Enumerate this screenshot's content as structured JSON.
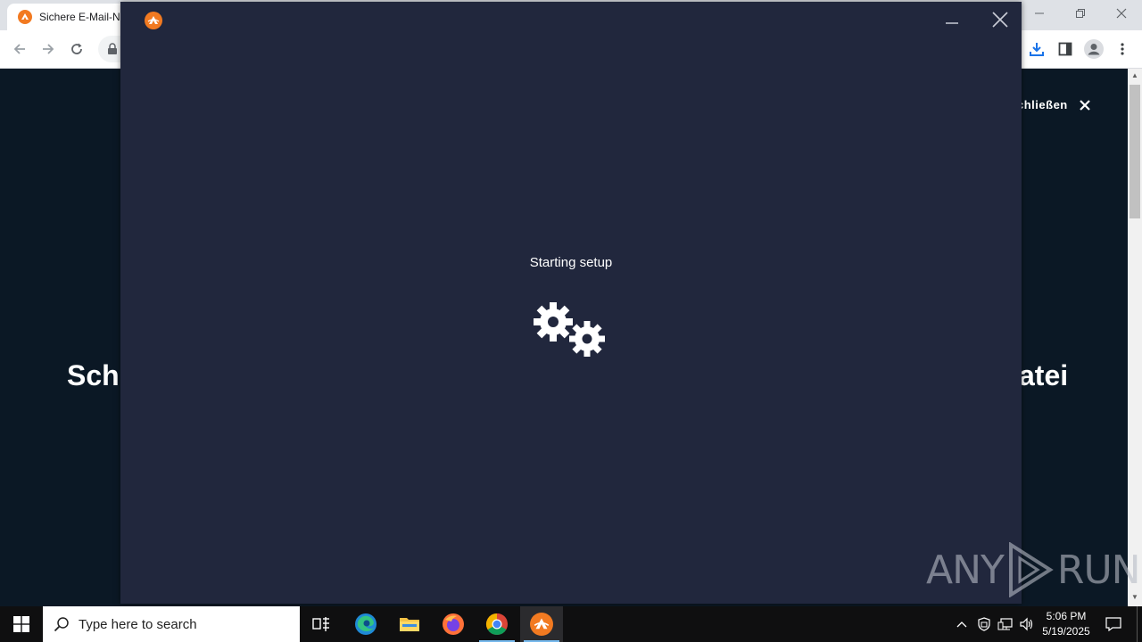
{
  "browser": {
    "tab_title": "Sichere E-Mail-Ne",
    "page": {
      "close_label": "chließen",
      "heading_left": "Schl",
      "heading_right": "atei"
    }
  },
  "installer": {
    "status_text": "Starting setup",
    "logo_color": "#f27a21",
    "background": "#21273d"
  },
  "watermark": {
    "left_text": "ANY",
    "right_text": "RUN"
  },
  "taskbar": {
    "search_placeholder": "Type here to search",
    "clock_time": "5:06 PM",
    "clock_date": "5/19/2025",
    "apps": [
      "task-view",
      "edge",
      "file-explorer",
      "firefox",
      "chrome",
      "avast-installer"
    ]
  }
}
